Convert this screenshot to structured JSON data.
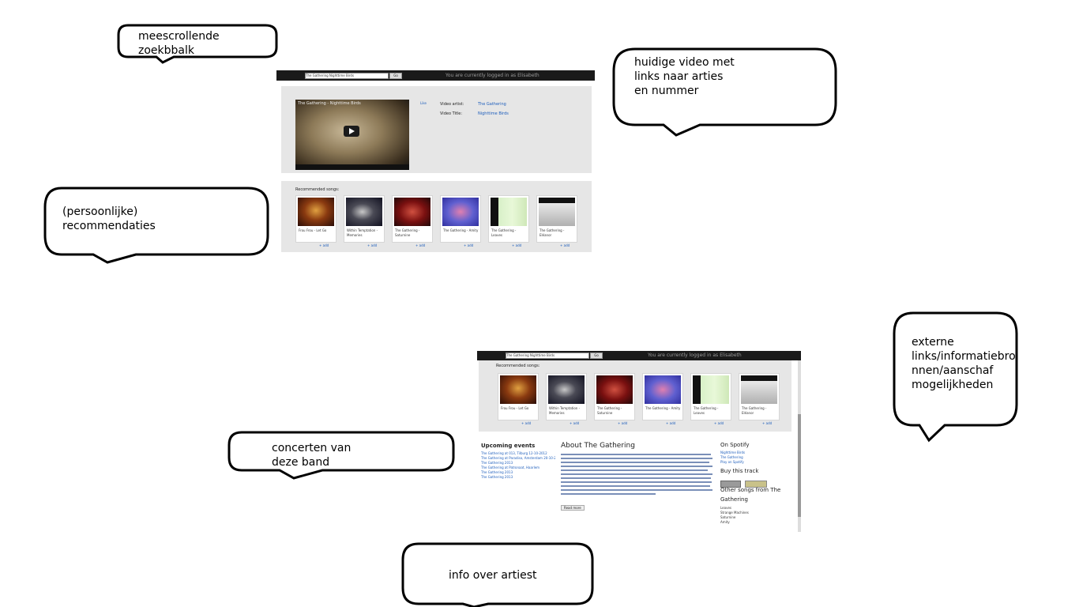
{
  "annotations": {
    "search_bar": "meescrollende zoekbbalk",
    "current_video": "huidige video met\nlinks naar arties\nen nummer",
    "recommendations": "(persoonlijke)\nrecommendaties",
    "external_links": "externe\nlinks/informatiebro\nnnen/aanschaf\nmogelijkheden",
    "concerts": "concerten van\ndeze band",
    "artist_info": "info over artiest"
  },
  "mockup1": {
    "now_playing": "You are currently logged in as Elisabeth",
    "search_value": "The Gathering Nighttime Birds",
    "search_button": "Go",
    "video_title": "The Gathering - Nighttime Birds",
    "like": "Like",
    "video_artist_label": "Video artist:",
    "video_artist": "The Gathering",
    "video_title_label": "Video Title:",
    "video_title_value": "Nighttime Birds",
    "recommended_heading": "Recommended songs:",
    "add_label": "+ add",
    "songs": [
      "Frou Frou - Let Go",
      "Within Temptation - Memories",
      "The Gathering - Saturnine",
      "The Gathering - Amity",
      "The Gathering - Leaves",
      "The Gathering - Eléanor"
    ]
  },
  "mockup2": {
    "now_playing": "You are currently logged in as Elisabeth",
    "search_value": "The Gathering Nighttime Birds",
    "search_button": "Go",
    "recommended_heading": "Recommended songs:",
    "add_label": "+ add",
    "songs": [
      "Frou Frou - Let Go",
      "Within Temptation - Memories",
      "The Gathering - Saturnine",
      "The Gathering - Amity",
      "The Gathering - Leaves",
      "The Gathering - Eléanor"
    ],
    "events_heading": "Upcoming events",
    "events": [
      "The Gathering at 013, Tilburg 12-10-2012",
      "The Gathering at Paradiso, Amsterdam 20-10-2012",
      "The Gathering 2013",
      "The Gathering at Patronaat, Haarlem",
      "The Gathering 2013",
      "The Gathering 2013"
    ],
    "about_heading": "About The Gathering",
    "more_button": "Read more",
    "spotify_heading": "On Spotify",
    "spotify_links": [
      "Nighttime Birds",
      "The Gathering",
      "Play on Spotify"
    ],
    "buy_heading": "Buy this track",
    "other_songs_heading": "Other songs from The Gathering",
    "other_songs": [
      "Leaves",
      "Strange Machines",
      "Saturnine",
      "Amity"
    ]
  },
  "colors": {
    "topbar": "#1a1a1a",
    "panel": "#e6e6e6",
    "link": "#1e5ebc"
  }
}
